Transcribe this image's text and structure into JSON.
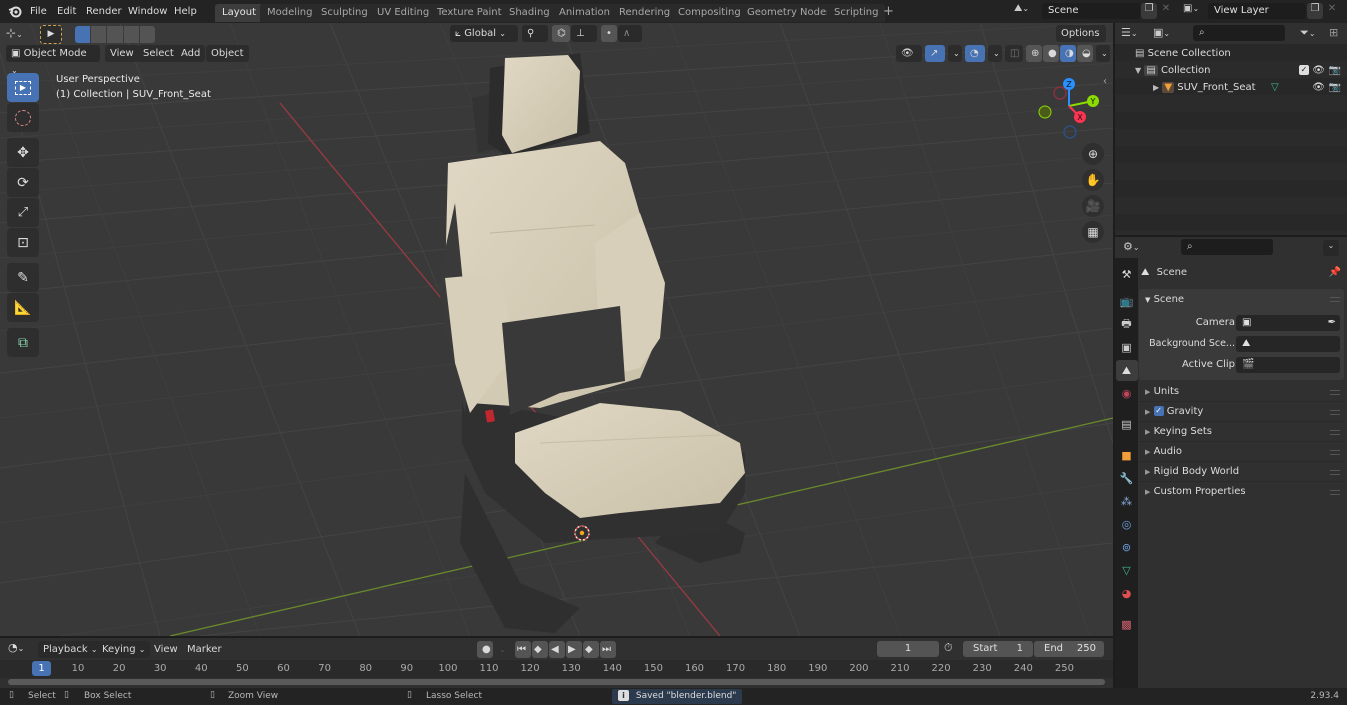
{
  "app": {
    "name": "Blender",
    "version": "2.93.4"
  },
  "menu": [
    "File",
    "Edit",
    "Render",
    "Window",
    "Help"
  ],
  "workspaces": [
    {
      "label": "Layout",
      "active": true
    },
    {
      "label": "Modeling"
    },
    {
      "label": "Sculpting"
    },
    {
      "label": "UV Editing"
    },
    {
      "label": "Texture Paint"
    },
    {
      "label": "Shading"
    },
    {
      "label": "Animation"
    },
    {
      "label": "Rendering"
    },
    {
      "label": "Compositing"
    },
    {
      "label": "Geometry Nodes"
    },
    {
      "label": "Scripting"
    }
  ],
  "add_workspace_icon": "+",
  "scene_selector": {
    "value": "Scene",
    "icon": "scene-icon"
  },
  "view_layer_selector": {
    "value": "View Layer",
    "icon": "view-layer-icon"
  },
  "viewport": {
    "header": {
      "mode": "Object Mode",
      "menus": [
        "View",
        "Select",
        "Add",
        "Object"
      ],
      "transform_orientation": "Global",
      "options_label": "Options"
    },
    "overlay_text": {
      "view_name": "User Perspective",
      "context": "(1) Collection | SUV_Front_Seat"
    },
    "tools": [
      {
        "name": "select-box",
        "active": true
      },
      {
        "name": "cursor"
      },
      {
        "name": "move"
      },
      {
        "name": "rotate"
      },
      {
        "name": "scale"
      },
      {
        "name": "transform"
      },
      {
        "name": "annotate"
      },
      {
        "name": "measure"
      },
      {
        "name": "add-cube"
      }
    ],
    "gizmo_axes": {
      "x": "X",
      "y": "Y",
      "z": "Z"
    },
    "colors": {
      "x": "#ff3352",
      "y": "#8bdc00",
      "z": "#2890ff",
      "active_tool": "#4772b3"
    }
  },
  "outliner": {
    "search_placeholder": "",
    "root": "Scene Collection",
    "items": [
      {
        "label": "Collection",
        "level": 1,
        "expanded": true,
        "checked": true
      },
      {
        "label": "SUV_Front_Seat",
        "level": 2,
        "expanded": false,
        "type": "mesh"
      }
    ]
  },
  "properties": {
    "search_placeholder": "",
    "context_title": "Scene",
    "section_title": "Scene",
    "fields": [
      {
        "label": "Camera",
        "value": ""
      },
      {
        "label": "Background Sce...",
        "value": ""
      },
      {
        "label": "Active Clip",
        "value": ""
      }
    ],
    "subpanels": [
      {
        "label": "Units"
      },
      {
        "label": "Gravity",
        "checkbox": true,
        "checked": true
      },
      {
        "label": "Keying Sets"
      },
      {
        "label": "Audio"
      },
      {
        "label": "Rigid Body World"
      },
      {
        "label": "Custom Properties"
      }
    ],
    "tabs": [
      "tool",
      "render",
      "output",
      "view-layer",
      "scene",
      "world",
      "collection",
      "object",
      "modifiers",
      "particles",
      "physics",
      "constraints",
      "data",
      "material",
      "texture"
    ],
    "active_tab": "scene"
  },
  "timeline": {
    "menus": [
      "Playback",
      "Keying",
      "View",
      "Marker"
    ],
    "current_frame": "1",
    "start_label": "Start",
    "start": "1",
    "end_label": "End",
    "end": "250",
    "ruler": [
      "10",
      "20",
      "30",
      "40",
      "50",
      "60",
      "70",
      "80",
      "90",
      "100",
      "110",
      "120",
      "130",
      "140",
      "150",
      "160",
      "170",
      "180",
      "190",
      "200",
      "210",
      "220",
      "230",
      "240",
      "250"
    ],
    "playhead": "1"
  },
  "statusbar": {
    "hints": [
      {
        "label": "Select",
        "icon": "mouse-left-icon"
      },
      {
        "label": "Box Select",
        "icon": "mouse-drag-icon"
      },
      {
        "label": "Zoom View",
        "icon": "mouse-middle-icon"
      },
      {
        "label": "Lasso Select",
        "icon": "mouse-right-icon"
      }
    ],
    "message": "Saved \"blender.blend\"",
    "version": "2.93.4"
  }
}
